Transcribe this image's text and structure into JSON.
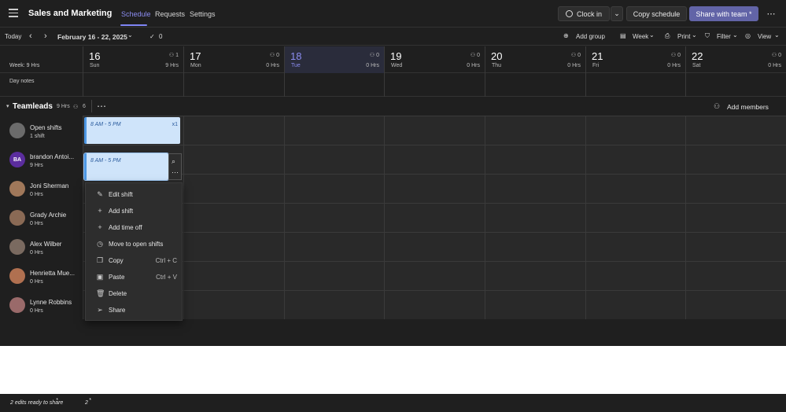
{
  "app": {
    "title": "Sales and Marketing"
  },
  "tabs": [
    {
      "label": "Schedule"
    },
    {
      "label": "Requests"
    },
    {
      "label": "Settings"
    }
  ],
  "actions": {
    "clock_in": "Clock in",
    "copy_schedule": "Copy schedule",
    "share": "Share with team *"
  },
  "toolbar": {
    "today": "Today",
    "range": "February 16 - 22, 2025",
    "check_count": "0",
    "add_group": "Add group",
    "week": "Week",
    "print": "Print",
    "filter": "Filter",
    "view": "View"
  },
  "header": {
    "week_label": "Week: 9 Hrs",
    "day_notes": "Day notes"
  },
  "days": [
    {
      "num": "16",
      "name": "Sun",
      "count": "1",
      "hrs": "9 Hrs"
    },
    {
      "num": "17",
      "name": "Mon",
      "count": "0",
      "hrs": "0 Hrs"
    },
    {
      "num": "18",
      "name": "Tue",
      "count": "0",
      "hrs": "0 Hrs"
    },
    {
      "num": "19",
      "name": "Wed",
      "count": "0",
      "hrs": "0 Hrs"
    },
    {
      "num": "20",
      "name": "Thu",
      "count": "0",
      "hrs": "0 Hrs"
    },
    {
      "num": "21",
      "name": "Fri",
      "count": "0",
      "hrs": "0 Hrs"
    },
    {
      "num": "22",
      "name": "Sat",
      "count": "0",
      "hrs": "0 Hrs"
    }
  ],
  "group": {
    "name": "Teamleads",
    "hrs": "9 Hrs",
    "members": "6",
    "add_members": "Add members"
  },
  "people": [
    {
      "name": "Open shifts",
      "sub": "1 shift",
      "initials": "",
      "color": "#6b6b6b"
    },
    {
      "name": "brandon Antoi...",
      "sub": "9 Hrs",
      "initials": "BA",
      "color": "#5b2d9e"
    },
    {
      "name": "Joni Sherman",
      "sub": "0 Hrs",
      "initials": "",
      "color": "#a0785a"
    },
    {
      "name": "Grady Archie",
      "sub": "0 Hrs",
      "initials": "",
      "color": "#8a6a55"
    },
    {
      "name": "Alex Wilber",
      "sub": "0 Hrs",
      "initials": "",
      "color": "#7a6a60"
    },
    {
      "name": "Henrietta Mue...",
      "sub": "0 Hrs",
      "initials": "",
      "color": "#b07050"
    },
    {
      "name": "Lynne Robbins",
      "sub": "0 Hrs",
      "initials": "",
      "color": "#9a6a6a"
    }
  ],
  "shifts": [
    {
      "time": "8 AM - 5 PM",
      "badge": "x1"
    },
    {
      "time": "8 AM - 5 PM",
      "badge": ""
    }
  ],
  "context_menu": [
    {
      "label": "Edit shift",
      "shortcut": "",
      "icon": "pencil-icon"
    },
    {
      "label": "Add shift",
      "shortcut": "",
      "icon": "plus-icon"
    },
    {
      "label": "Add time off",
      "shortcut": "",
      "icon": "plus-icon"
    },
    {
      "label": "Move to open shifts",
      "shortcut": "",
      "icon": "clock-icon"
    },
    {
      "label": "Copy",
      "shortcut": "Ctrl + C",
      "icon": "copy-icon"
    },
    {
      "label": "Paste",
      "shortcut": "Ctrl + V",
      "icon": "paste-icon"
    },
    {
      "label": "Delete",
      "shortcut": "",
      "icon": "trash-icon"
    },
    {
      "label": "Share",
      "shortcut": "",
      "icon": "share-icon"
    }
  ],
  "footer": {
    "edits": "2 edits ready to share",
    "count": "2"
  },
  "colors": {
    "accent": "#6264a7",
    "shift_bg": "#cfe4fa",
    "shift_border": "#4c97e4",
    "bg": "#1f1f1f"
  }
}
